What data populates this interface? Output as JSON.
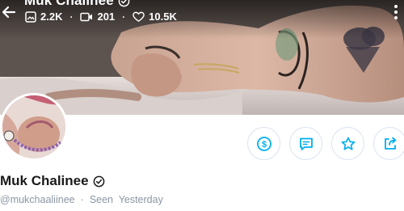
{
  "cover": {
    "title": "Muk Chalinee",
    "stats": [
      {
        "icon": "image-icon",
        "value": "2.2K"
      },
      {
        "icon": "video-icon",
        "value": "201"
      },
      {
        "icon": "heart-icon",
        "value": "10.5K"
      }
    ]
  },
  "profile": {
    "display_name": "Muk Chalinee",
    "handle": "@mukchaaliinee",
    "separator": "·",
    "last_seen": "Seen  Yesterday"
  },
  "actions": [
    {
      "name": "tip-button",
      "icon": "dollar-icon"
    },
    {
      "name": "message-button",
      "icon": "message-icon"
    },
    {
      "name": "favorite-button",
      "icon": "star-icon"
    },
    {
      "name": "share-button",
      "icon": "share-icon"
    }
  ],
  "colors": {
    "accent": "#00aff0",
    "text_primary": "#1a1a1a",
    "text_muted": "#8a96a3",
    "button_border": "#d9e3ef"
  }
}
